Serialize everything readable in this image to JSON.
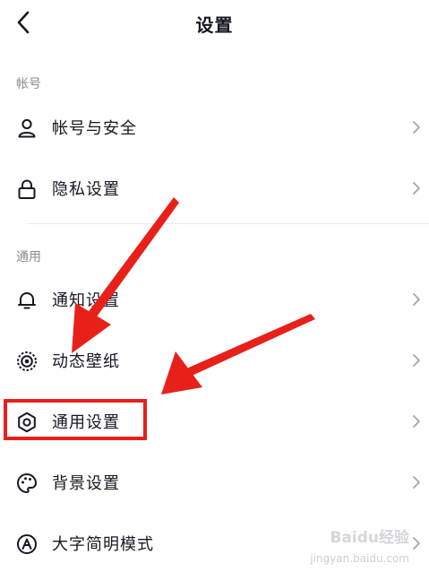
{
  "header": {
    "title": "设置"
  },
  "sections": {
    "account": {
      "label": "帐号"
    },
    "general": {
      "label": "通用"
    }
  },
  "items": [
    {
      "label": "帐号与安全",
      "icon": "user-icon"
    },
    {
      "label": "隐私设置",
      "icon": "lock-icon"
    },
    {
      "label": "通知设置",
      "icon": "bell-icon"
    },
    {
      "label": "动态壁纸",
      "icon": "dynamic-wallpaper-icon"
    },
    {
      "label": "通用设置",
      "icon": "gear-icon"
    },
    {
      "label": "背景设置",
      "icon": "palette-icon"
    },
    {
      "label": "大字简明模式",
      "icon": "large-font-icon"
    }
  ],
  "annotation": {
    "color": "#e8201a",
    "highlighted_item": "通用设置"
  },
  "watermark": {
    "brand": "Baidu经验",
    "url": "jingyan.baidu.com"
  }
}
